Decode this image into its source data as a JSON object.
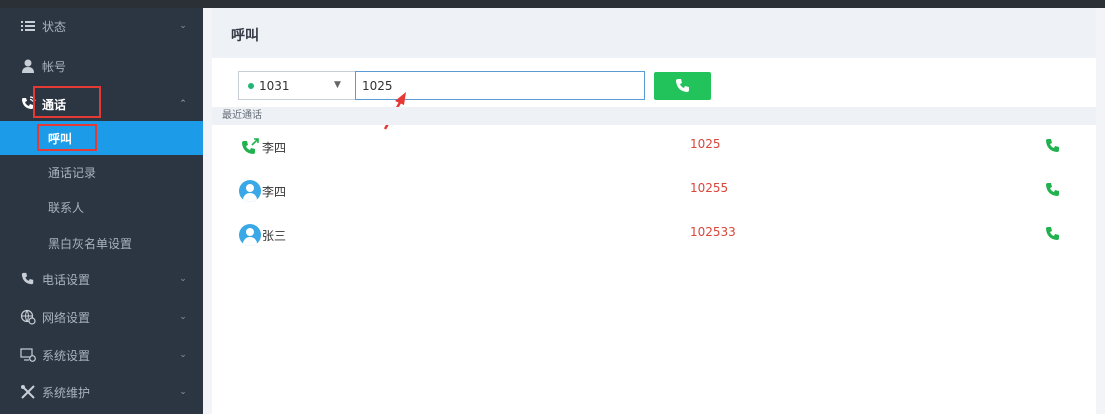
{
  "sidebar": {
    "items": [
      {
        "label": "状态",
        "icon": "list-icon"
      },
      {
        "label": "帐号",
        "icon": "user-icon"
      },
      {
        "label": "通话",
        "icon": "phone-call-icon",
        "active": true
      },
      {
        "label": "电话设置",
        "icon": "phone-icon"
      },
      {
        "label": "网络设置",
        "icon": "network-gear-icon"
      },
      {
        "label": "系统设置",
        "icon": "monitor-gear-icon"
      },
      {
        "label": "系统维护",
        "icon": "tools-icon"
      }
    ],
    "sub_items": [
      {
        "label": "呼叫",
        "selected": true
      },
      {
        "label": "通话记录"
      },
      {
        "label": "联系人"
      },
      {
        "label": "黑白灰名单设置"
      }
    ]
  },
  "main": {
    "title": "呼叫",
    "line_select": {
      "value": "1031"
    },
    "dial_input": {
      "value": "1025"
    },
    "recent_header": "最近通话",
    "recent": [
      {
        "name": "李四",
        "number": "1025",
        "icon": "outgoing-call-icon"
      },
      {
        "name": "李四",
        "number": "10255",
        "icon": "avatar-icon"
      },
      {
        "name": "张三",
        "number": "102533",
        "icon": "avatar-icon"
      }
    ]
  },
  "colors": {
    "sidebar_bg": "#2c3542",
    "selected_blue": "#1b9be8",
    "call_green": "#21c35a",
    "number_red": "#d9463a",
    "annotation_red": "#e53935"
  }
}
